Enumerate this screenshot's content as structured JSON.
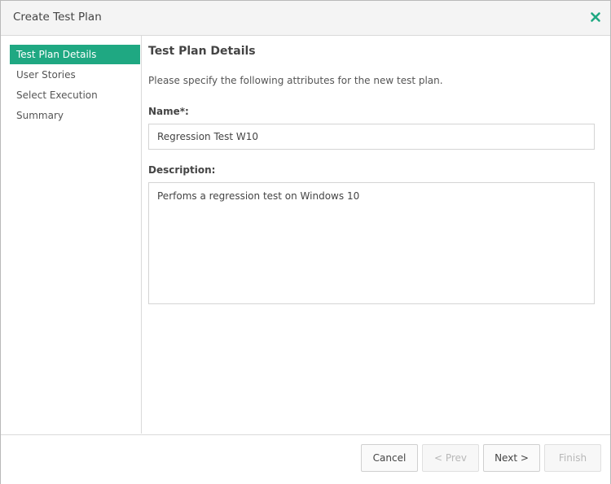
{
  "dialog": {
    "title": "Create Test Plan",
    "close_icon": "close-x-icon",
    "accent_color": "#1fa882"
  },
  "sidebar": {
    "items": [
      {
        "label": "Test Plan Details",
        "active": true
      },
      {
        "label": "User Stories",
        "active": false
      },
      {
        "label": "Select Execution",
        "active": false
      },
      {
        "label": "Summary",
        "active": false
      }
    ]
  },
  "main": {
    "section_title": "Test Plan Details",
    "intro": "Please specify the following attributes for the new test plan.",
    "name_label": "Name*:",
    "name_value": "Regression Test W10",
    "description_label": "Description:",
    "description_value": "Perfoms a regression test on Windows 10"
  },
  "footer": {
    "cancel_label": "Cancel",
    "prev_label": "< Prev",
    "next_label": "Next >",
    "finish_label": "Finish"
  }
}
